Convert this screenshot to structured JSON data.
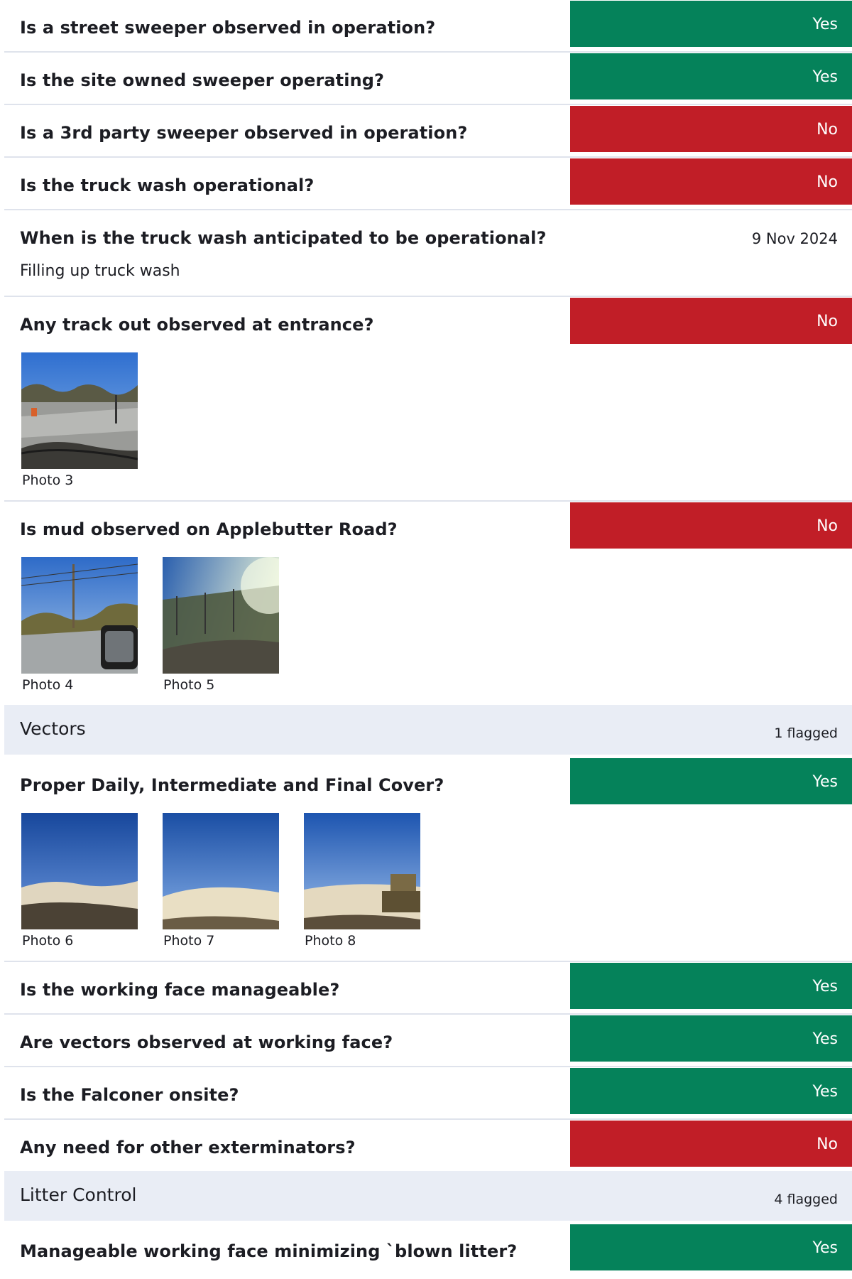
{
  "items": [
    {
      "question": "Is a street sweeper observed in operation?",
      "answer": "Yes"
    },
    {
      "question": "Is the site owned sweeper operating?",
      "answer": "Yes"
    },
    {
      "question": "Is a 3rd party sweeper observed in operation?",
      "answer": "No"
    },
    {
      "question": "Is the truck wash operational?",
      "answer": "No"
    },
    {
      "question": "When is the truck wash anticipated to be operational?",
      "answer": "9 Nov 2024",
      "note": "Filling up truck wash"
    },
    {
      "question": "Any track out observed at entrance?",
      "answer": "No",
      "photos": [
        "Photo 3"
      ]
    },
    {
      "question": "Is mud observed on Applebutter Road?",
      "answer": "No",
      "photos": [
        "Photo 4",
        "Photo 5"
      ]
    }
  ],
  "sections": [
    {
      "title": "Vectors",
      "flagged": "1 flagged",
      "items": [
        {
          "question": "Proper Daily, Intermediate and Final Cover?",
          "answer": "Yes",
          "photos": [
            "Photo 6",
            "Photo 7",
            "Photo 8"
          ]
        },
        {
          "question": "Is the working face manageable?",
          "answer": "Yes"
        },
        {
          "question": "Are vectors observed at working face?",
          "answer": "Yes"
        },
        {
          "question": "Is the Falconer onsite?",
          "answer": "Yes"
        },
        {
          "question": "Any need for other exterminators?",
          "answer": "No"
        }
      ]
    },
    {
      "title": "Litter Control",
      "flagged": "4 flagged",
      "items": [
        {
          "question": "Manageable working face minimizing `blown litter?",
          "answer": "Yes"
        }
      ]
    }
  ],
  "colors": {
    "yes": "#05825a",
    "no": "#c11e27",
    "section_bg": "#e9edf5"
  },
  "icons": []
}
